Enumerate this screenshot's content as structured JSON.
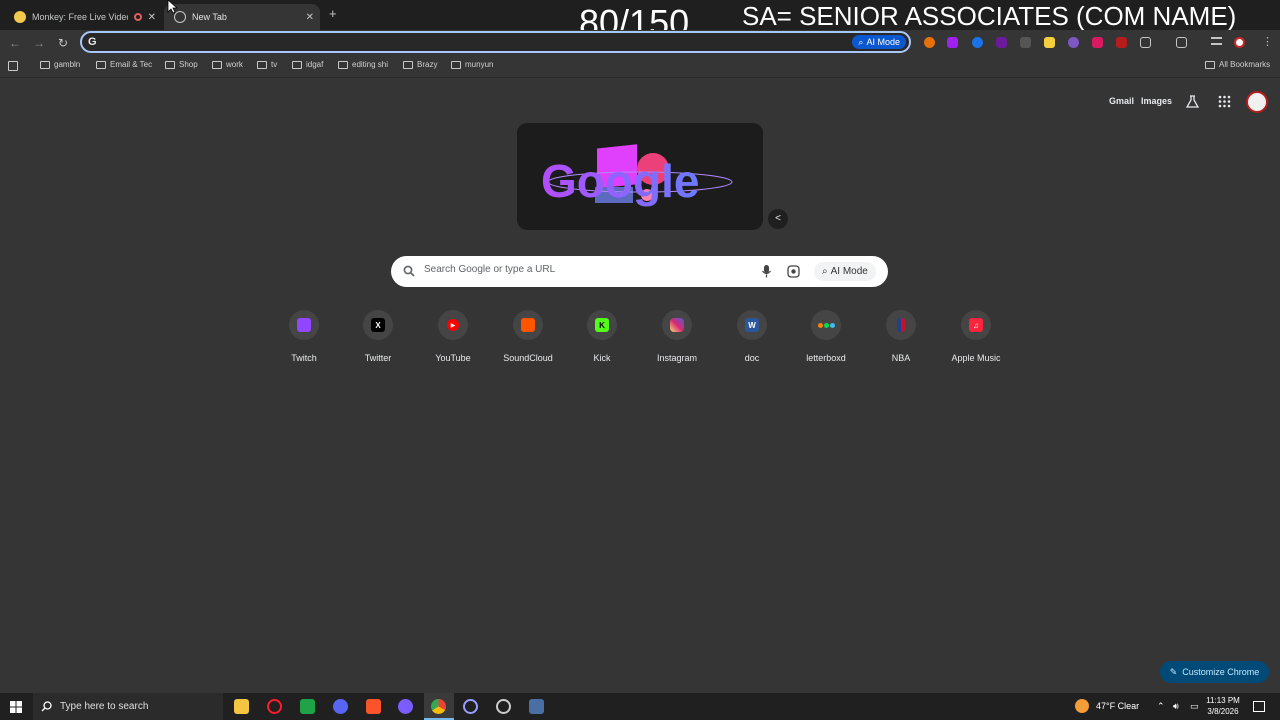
{
  "tabs": [
    {
      "title": "Monkey: Free Live Video Ch",
      "active": false
    },
    {
      "title": "New Tab",
      "active": true
    }
  ],
  "overlay": {
    "counter": "80/150",
    "caption": "SA= SENIOR ASSOCIATES (COM NAME)"
  },
  "omnibox": {
    "value": "",
    "ai_mode_label": "AI Mode"
  },
  "bookmarks": [
    "gambln",
    "Email & Tec",
    "Shop",
    "work",
    "tv",
    "idgaf",
    "editing shi",
    "Brazy",
    "munyun"
  ],
  "all_bookmarks_label": "All Bookmarks",
  "header_links": {
    "gmail": "Gmail",
    "images": "Images"
  },
  "doodle": {
    "text": "Google"
  },
  "search": {
    "placeholder": "Search Google or type a URL",
    "ai_mode_label": "AI Mode"
  },
  "shortcuts": [
    {
      "label": "Twitch",
      "icon": "twitch-icon",
      "color": "#9146ff"
    },
    {
      "label": "Twitter",
      "icon": "x-icon",
      "color": "#000000"
    },
    {
      "label": "YouTube",
      "icon": "youtube-icon",
      "color": "#ff0000"
    },
    {
      "label": "SoundCloud",
      "icon": "soundcloud-icon",
      "color": "#ff5500"
    },
    {
      "label": "Kick",
      "icon": "kick-icon",
      "color": "#53fc18"
    },
    {
      "label": "Instagram",
      "icon": "instagram-icon",
      "color": "#d62976"
    },
    {
      "label": "doc",
      "icon": "word-icon",
      "color": "#2b579a"
    },
    {
      "label": "letterboxd",
      "icon": "letterboxd-icon",
      "color": "#00e054"
    },
    {
      "label": "NBA",
      "icon": "nba-icon",
      "color": "#1d428a"
    },
    {
      "label": "Apple Music",
      "icon": "apple-music-icon",
      "color": "#fa243c"
    }
  ],
  "customize_label": "Customize Chrome",
  "taskbar": {
    "search_placeholder": "Type here to search",
    "weather": "47°F  Clear",
    "time": "11:13 PM",
    "date": "3/8/2026"
  }
}
